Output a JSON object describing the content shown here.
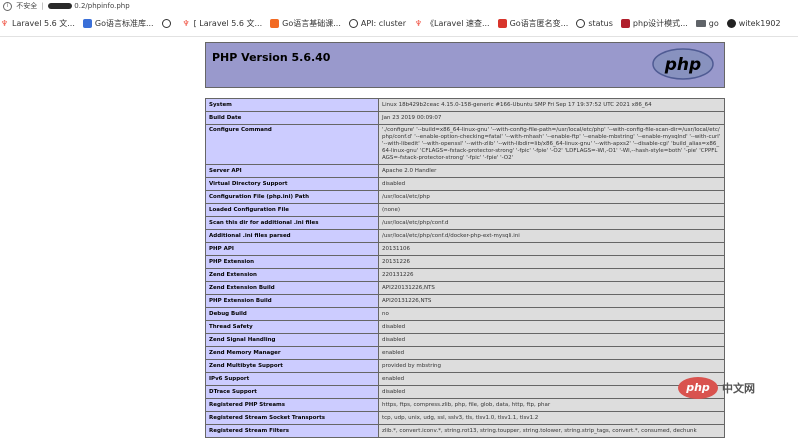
{
  "browser": {
    "security_label": "不安全",
    "url_suffix": "0.2/phpinfo.php",
    "bookmarks": [
      {
        "icon": "laravel-icon",
        "label": "Laravel 5.6 文..."
      },
      {
        "icon": "bookmark-blue-icon",
        "label": "Go语言标准库..."
      },
      {
        "icon": "globe-icon",
        "label": ""
      },
      {
        "icon": "laravel-icon",
        "label": "[ Laravel 5.6 文..."
      },
      {
        "icon": "bookmark-orange-icon",
        "label": "Go语言基础课..."
      },
      {
        "icon": "globe-icon",
        "label": "API: cluster"
      },
      {
        "icon": "laravel-icon",
        "label": "《Laravel 速查..."
      },
      {
        "icon": "bookmark-red-icon",
        "label": "Go语言匿名变..."
      },
      {
        "icon": "globe-icon",
        "label": "status"
      },
      {
        "icon": "bookmark-darkred-icon",
        "label": "php设计模式..."
      },
      {
        "icon": "folder-icon",
        "label": "go"
      },
      {
        "icon": "github-icon",
        "label": "witek1902"
      }
    ]
  },
  "phpinfo": {
    "title": "PHP Version 5.6.40",
    "logo_text": "php",
    "rows": [
      {
        "key": "System",
        "value": "Linux 18b429b2ceac 4.15.0-158-generic #166-Ubuntu SMP Fri Sep 17 19:37:52 UTC 2021 x86_64"
      },
      {
        "key": "Build Date",
        "value": "Jan 23 2019 00:09:07"
      },
      {
        "key": "Configure Command",
        "value": "'./configure' '--build=x86_64-linux-gnu' '--with-config-file-path=/usr/local/etc/php' '--with-config-file-scan-dir=/usr/local/etc/php/conf.d' '--enable-option-checking=fatal' '--with-mhash' '--enable-ftp' '--enable-mbstring' '--enable-mysqlnd' '--with-curl' '--with-libedit' '--with-openssl' '--with-zlib' '--with-libdir=lib/x86_64-linux-gnu' '--with-apxs2' '--disable-cgi' 'build_alias=x86_64-linux-gnu' 'CFLAGS=-fstack-protector-strong' '-fpic' '-fpie' '-O2' 'LDFLAGS=-Wl,-O1' '-Wl,--hash-style=both' '-pie' 'CPPFLAGS=-fstack-protector-strong' '-fpic' '-fpie' '-O2'"
      },
      {
        "key": "Server API",
        "value": "Apache 2.0 Handler"
      },
      {
        "key": "Virtual Directory Support",
        "value": "disabled"
      },
      {
        "key": "Configuration File (php.ini) Path",
        "value": "/usr/local/etc/php"
      },
      {
        "key": "Loaded Configuration File",
        "value": "(none)"
      },
      {
        "key": "Scan this dir for additional .ini files",
        "value": "/usr/local/etc/php/conf.d"
      },
      {
        "key": "Additional .ini files parsed",
        "value": "/usr/local/etc/php/conf.d/docker-php-ext-mysqli.ini"
      },
      {
        "key": "PHP API",
        "value": "20131106"
      },
      {
        "key": "PHP Extension",
        "value": "20131226"
      },
      {
        "key": "Zend Extension",
        "value": "220131226"
      },
      {
        "key": "Zend Extension Build",
        "value": "API220131226,NTS"
      },
      {
        "key": "PHP Extension Build",
        "value": "API20131226,NTS"
      },
      {
        "key": "Debug Build",
        "value": "no"
      },
      {
        "key": "Thread Safety",
        "value": "disabled"
      },
      {
        "key": "Zend Signal Handling",
        "value": "disabled"
      },
      {
        "key": "Zend Memory Manager",
        "value": "enabled"
      },
      {
        "key": "Zend Multibyte Support",
        "value": "provided by mbstring"
      },
      {
        "key": "IPv6 Support",
        "value": "enabled"
      },
      {
        "key": "DTrace Support",
        "value": "disabled"
      },
      {
        "key": "Registered PHP Streams",
        "value": "https, ftps, compress.zlib, php, file, glob, data, http, ftp, phar"
      },
      {
        "key": "Registered Stream Socket Transports",
        "value": "tcp, udp, unix, udg, ssl, sslv3, tls, tlsv1.0, tlsv1.1, tlsv1.2"
      },
      {
        "key": "Registered Stream Filters",
        "value": "zlib.*, convert.iconv.*, string.rot13, string.toupper, string.tolower, string.strip_tags, convert.*, consumed, dechunk"
      }
    ]
  },
  "watermark": {
    "logo_text": "php",
    "site_text": "中文网"
  },
  "colors": {
    "header_bg": "#9999cc",
    "key_bg": "#ccccff",
    "value_bg": "#dddddd"
  }
}
